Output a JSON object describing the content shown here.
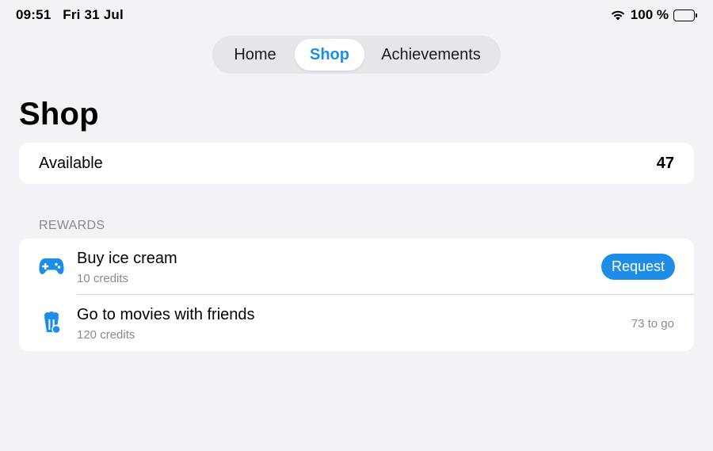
{
  "status": {
    "time": "09:51",
    "date": "Fri 31 Jul",
    "battery": "100 %",
    "battery_level": 1.0
  },
  "tabs": [
    {
      "label": "Home"
    },
    {
      "label": "Shop"
    },
    {
      "label": "Achievements"
    }
  ],
  "selected_tab": "Shop",
  "page": {
    "title": "Shop"
  },
  "available": {
    "label": "Available",
    "value": "47"
  },
  "rewards": {
    "header": "REWARDS",
    "items": [
      {
        "title": "Buy ice cream",
        "cost": "10 credits",
        "icon": "gamecontroller-icon",
        "action": "Request"
      },
      {
        "title": "Go to movies with friends",
        "cost": "120 credits",
        "icon": "popcorn-icon",
        "status": "73 to go"
      }
    ]
  },
  "colors": {
    "accent": "#1e8de8",
    "background": "#f2f2f7",
    "card": "#ffffff",
    "secondary_text": "#8a8a8e"
  }
}
